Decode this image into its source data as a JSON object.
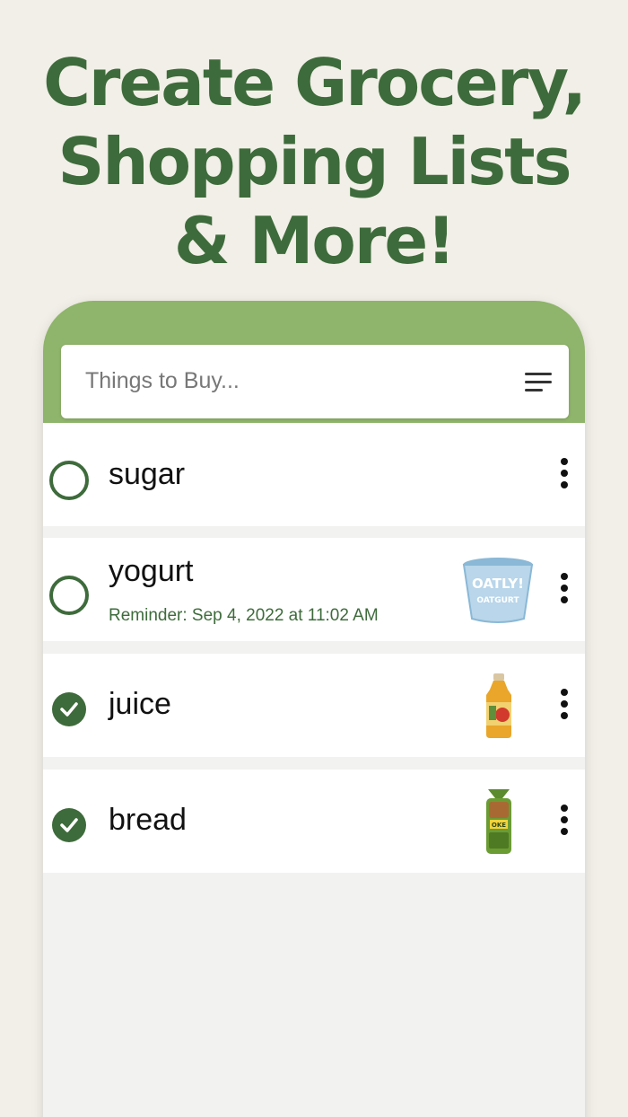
{
  "headline": {
    "line1": "Create Grocery,",
    "line2": "Shopping Lists",
    "line3": "& More!"
  },
  "search": {
    "placeholder": "Things to Buy...",
    "icon": "menu-icon"
  },
  "items": [
    {
      "name": "sugar",
      "checked": false,
      "reminder": "",
      "image": ""
    },
    {
      "name": "yogurt",
      "checked": false,
      "reminder": "Reminder: Sep 4, 2022 at 11:02 AM",
      "image": "yogurt-cup"
    },
    {
      "name": "juice",
      "checked": true,
      "reminder": "",
      "image": "juice-bottle"
    },
    {
      "name": "bread",
      "checked": true,
      "reminder": "",
      "image": "bread-loaf"
    }
  ],
  "colors": {
    "brand_green": "#3e6b3b",
    "header_green": "#8fb46b",
    "background": "#f1efe7"
  }
}
